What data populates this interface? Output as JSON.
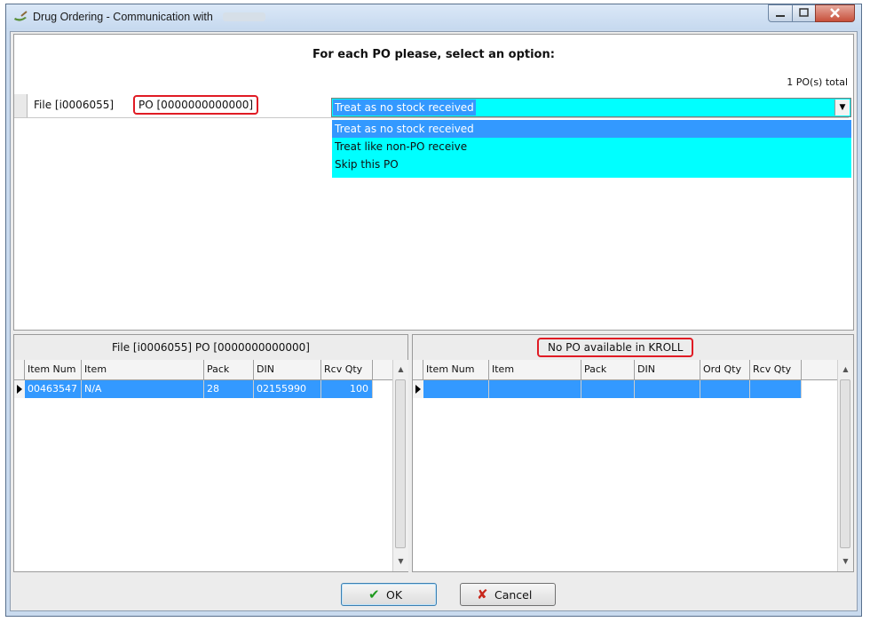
{
  "window": {
    "title": "Drug Ordering - Communication with",
    "icon": "pill-spoon-icon"
  },
  "top_panel": {
    "heading": "For each PO please, select an option:",
    "total": "1 PO(s) total",
    "row": {
      "file": "File [i0006055]",
      "po": "PO [0000000000000]"
    },
    "combo": {
      "selected": "Treat as no stock received",
      "options": [
        "Treat as no stock received",
        "Treat like non-PO receive",
        "Skip this PO"
      ]
    }
  },
  "left_panel": {
    "title": "File [i0006055] PO [0000000000000]",
    "columns": [
      "Item Num",
      "Item",
      "Pack",
      "DIN",
      "Rcv Qty"
    ],
    "rows": [
      {
        "item_num": "00463547",
        "item": "N/A",
        "pack": "28",
        "din": "02155990",
        "rcv_qty": "100"
      }
    ]
  },
  "right_panel": {
    "title": "No PO available in KROLL",
    "columns": [
      "Item Num",
      "Item",
      "Pack",
      "DIN",
      "Ord Qty",
      "Rcv Qty"
    ]
  },
  "buttons": {
    "ok": "OK",
    "cancel": "Cancel"
  },
  "colors": {
    "highlight": "#3399ff",
    "combo_bg": "#00ffff",
    "callout": "#e01b24"
  }
}
